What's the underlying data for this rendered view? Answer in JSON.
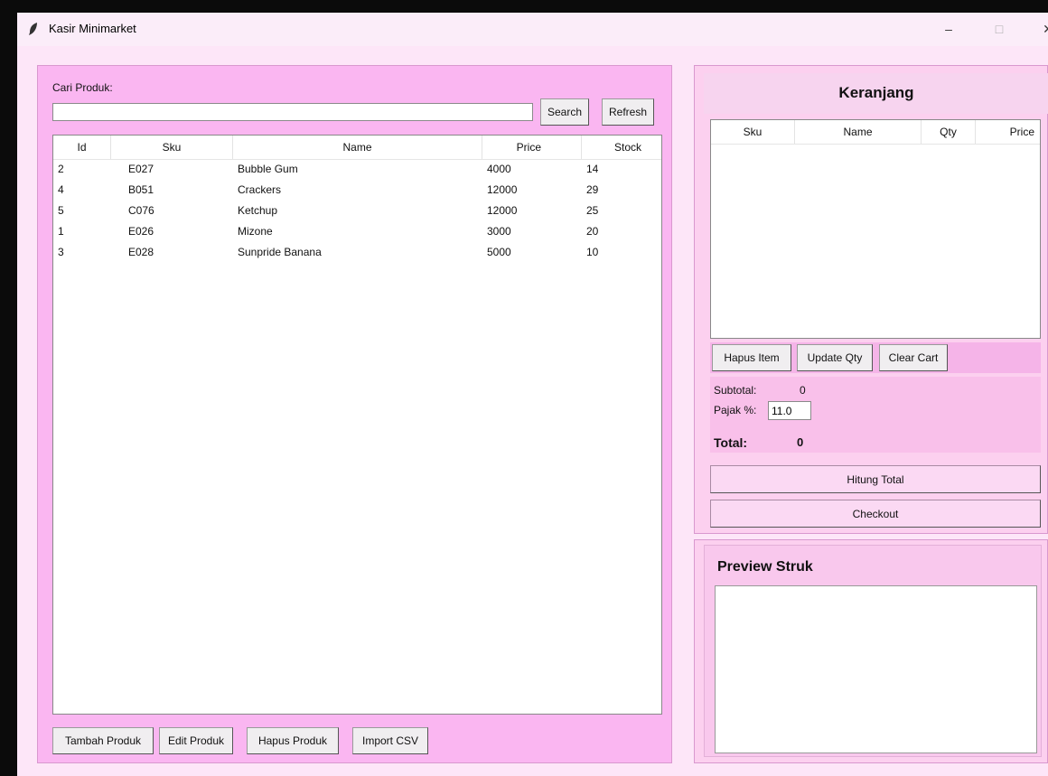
{
  "window": {
    "title": "Kasir Minimarket",
    "controls": {
      "minimize": "–",
      "maximize": "□",
      "close": "✕"
    }
  },
  "search": {
    "label": "Cari Produk:",
    "value": "",
    "search_button": "Search",
    "refresh_button": "Refresh"
  },
  "products": {
    "columns": [
      "Id",
      "Sku",
      "Name",
      "Price",
      "Stock"
    ],
    "rows": [
      [
        "2",
        "E027",
        "Bubble Gum",
        "4000",
        "14"
      ],
      [
        "4",
        "B051",
        "Crackers",
        "12000",
        "29"
      ],
      [
        "5",
        "C076",
        "Ketchup",
        "12000",
        "25"
      ],
      [
        "1",
        "E026",
        "Mizone",
        "3000",
        "20"
      ],
      [
        "3",
        "E028",
        "Sunpride Banana",
        "5000",
        "10"
      ]
    ]
  },
  "product_buttons": {
    "add": "Tambah Produk",
    "edit": "Edit Produk",
    "delete": "Hapus Produk",
    "import": "Import CSV"
  },
  "cart": {
    "title": "Keranjang",
    "columns": [
      "Sku",
      "Name",
      "Qty",
      "Price"
    ],
    "remove_item": "Hapus Item",
    "update_qty": "Update Qty",
    "clear_cart": "Clear Cart",
    "subtotal_label": "Subtotal:",
    "subtotal_value": "0",
    "tax_label": "Pajak %:",
    "tax_value": "11.0",
    "total_label": "Total:",
    "total_value": "0",
    "compute_button": "Hitung Total",
    "checkout_button": "Checkout"
  },
  "preview": {
    "title": "Preview Struk"
  },
  "colors": {
    "window_bg": "#fde6f8",
    "panel_bg": "#fab6f1",
    "cart_bg": "#fcd0ef"
  }
}
